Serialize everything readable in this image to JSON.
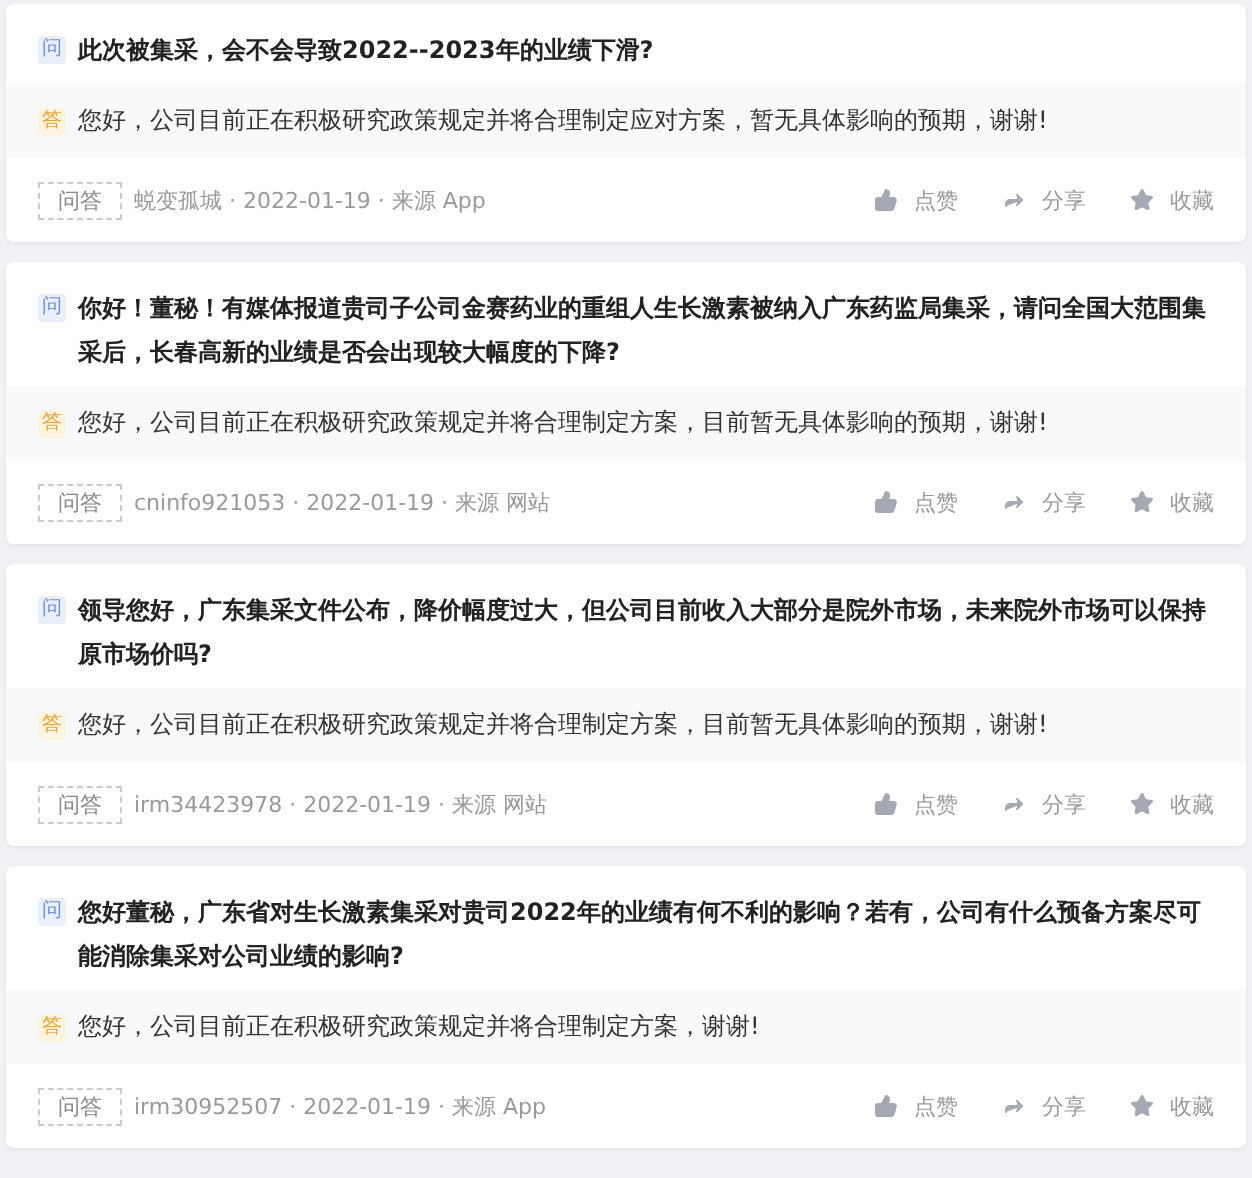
{
  "posts": [
    {
      "question_badge": "问",
      "question": "此次被集采，会不会导致2022--2023年的业绩下滑?",
      "answer_badge": "答",
      "answer": "您好，公司目前正在积极研究政策规定并将合理制定应对方案，暂无具体影响的预期，谢谢!",
      "tag": "问答",
      "meta": "蜕变孤城 · 2022-01-19 · 来源 App",
      "actions": [
        {
          "kind": "like",
          "label": "点赞"
        },
        {
          "kind": "share",
          "label": "分享"
        },
        {
          "kind": "favorite",
          "label": "收藏"
        }
      ]
    },
    {
      "question_badge": "问",
      "question": "你好！董秘！有媒体报道贵司子公司金赛药业的重组人生长激素被纳入广东药监局集采，请问全国大范围集采后，长春高新的业绩是否会出现较大幅度的下降?",
      "answer_badge": "答",
      "answer": "您好，公司目前正在积极研究政策规定并将合理制定方案，目前暂无具体影响的预期，谢谢!",
      "tag": "问答",
      "meta": "cninfo921053 · 2022-01-19 · 来源 网站",
      "actions": [
        {
          "kind": "like",
          "label": "点赞"
        },
        {
          "kind": "share",
          "label": "分享"
        },
        {
          "kind": "favorite",
          "label": "收藏"
        }
      ]
    },
    {
      "question_badge": "问",
      "question": "领导您好，广东集采文件公布，降价幅度过大，但公司目前收入大部分是院外市场，未来院外市场可以保持原市场价吗?",
      "answer_badge": "答",
      "answer": "您好，公司目前正在积极研究政策规定并将合理制定方案，目前暂无具体影响的预期，谢谢!",
      "tag": "问答",
      "meta": "irm34423978 · 2022-01-19 · 来源 网站",
      "actions": [
        {
          "kind": "like",
          "label": "点赞"
        },
        {
          "kind": "share",
          "label": "分享"
        },
        {
          "kind": "favorite",
          "label": "收藏"
        }
      ]
    },
    {
      "question_badge": "问",
      "question": "您好董秘，广东省对生长激素集采对贵司2022年的业绩有何不利的影响？若有，公司有什么预备方案尽可能消除集采对公司业绩的影响?",
      "answer_badge": "答",
      "answer": "您好，公司目前正在积极研究政策规定并将合理制定方案，谢谢!",
      "tag": "问答",
      "meta": "irm30952507 · 2022-01-19 · 来源 App",
      "actions": [
        {
          "kind": "like",
          "label": "点赞"
        },
        {
          "kind": "share",
          "label": "分享"
        },
        {
          "kind": "favorite",
          "label": "收藏"
        }
      ]
    }
  ]
}
